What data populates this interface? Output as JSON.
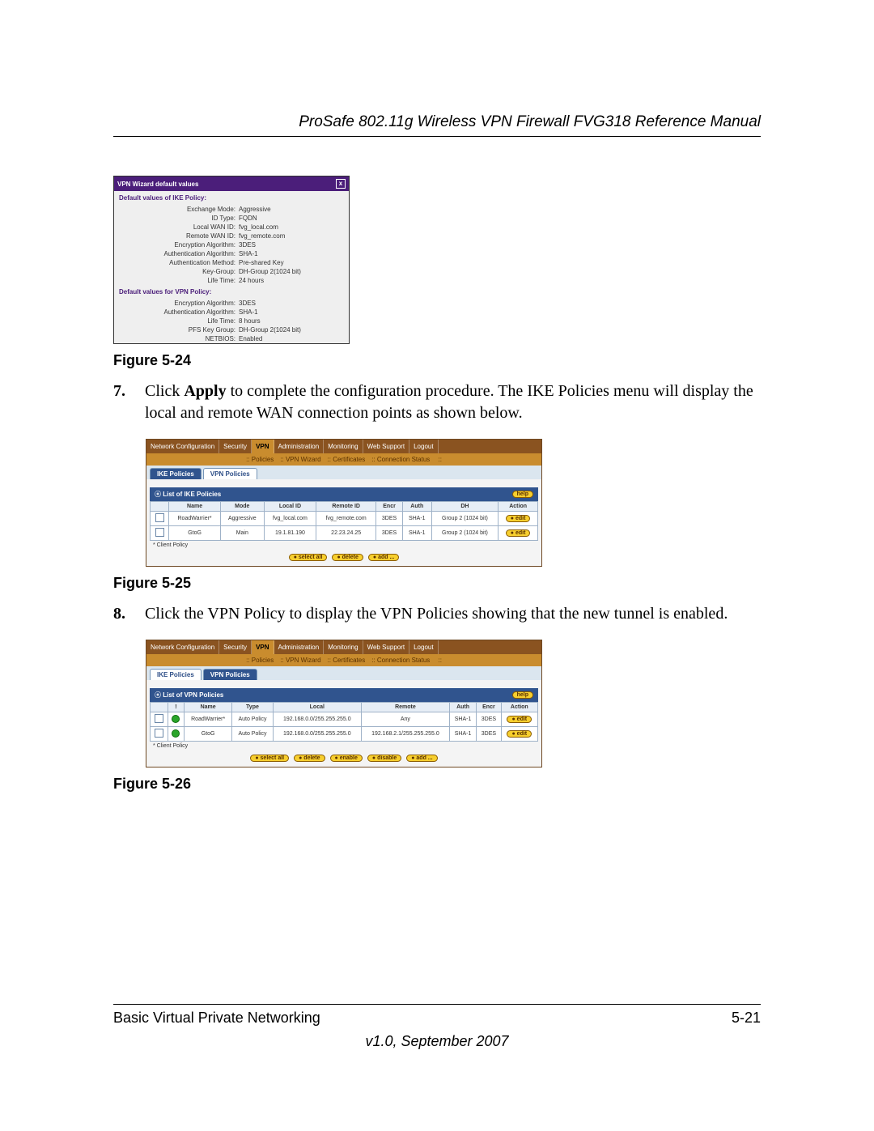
{
  "header": {
    "title": "ProSafe 802.11g Wireless VPN Firewall FVG318 Reference Manual"
  },
  "captions": {
    "f24": "Figure 5-24",
    "f25": "Figure 5-25",
    "f26": "Figure 5-26"
  },
  "step7": {
    "num": "7.",
    "lead": "Click ",
    "bold": "Apply",
    "rest": " to complete the configuration procedure. The IKE Policies menu will display the local and remote WAN connection points as shown below."
  },
  "step8": {
    "num": "8.",
    "text": "Click the VPN Policy to display the VPN Policies showing that the new tunnel is enabled."
  },
  "footer": {
    "left": "Basic Virtual Private Networking",
    "right": "5-21",
    "ver": "v1.0, September 2007"
  },
  "panel524": {
    "title": "VPN Wizard default values",
    "ike_head": "Default values of IKE Policy:",
    "ike": [
      {
        "k": "Exchange Mode:",
        "v": "Aggressive"
      },
      {
        "k": "ID Type:",
        "v": "FQDN"
      },
      {
        "k": "Local WAN ID:",
        "v": "fvg_local.com"
      },
      {
        "k": "Remote WAN ID:",
        "v": "fvg_remote.com"
      },
      {
        "k": "Encryption Algorithm:",
        "v": "3DES"
      },
      {
        "k": "Authentication Algorithm:",
        "v": "SHA-1"
      },
      {
        "k": "Authentication Method:",
        "v": "Pre-shared Key"
      },
      {
        "k": "Key-Group:",
        "v": "DH-Group 2(1024 bit)"
      },
      {
        "k": "Life Time:",
        "v": "24 hours"
      }
    ],
    "vpn_head": "Default values for VPN Policy:",
    "vpn": [
      {
        "k": "Encryption Algorithm:",
        "v": "3DES"
      },
      {
        "k": "Authentication Algorithm:",
        "v": "SHA-1"
      },
      {
        "k": "Life Time:",
        "v": "8 hours"
      },
      {
        "k": "PFS Key Group:",
        "v": "DH-Group 2(1024 bit)"
      },
      {
        "k": "NETBIOS:",
        "v": "Enabled"
      }
    ]
  },
  "router_common": {
    "nav": [
      "Network Configuration",
      "Security",
      "VPN",
      "Administration",
      "Monitoring",
      "Web Support",
      "Logout"
    ],
    "subnav": [
      "Policies",
      "VPN Wizard",
      "Certificates",
      "Connection Status"
    ],
    "tabs": [
      "IKE Policies",
      "VPN Policies"
    ],
    "help": "help",
    "note": "* Client Policy",
    "buttons_basic": [
      "select all",
      "delete",
      "add ..."
    ],
    "buttons_full": [
      "select all",
      "delete",
      "enable",
      "disable",
      "add ..."
    ]
  },
  "fig25": {
    "listTitle": "List of IKE Policies",
    "headers": [
      "",
      "Name",
      "Mode",
      "Local ID",
      "Remote ID",
      "Encr",
      "Auth",
      "DH",
      "Action"
    ],
    "rows": [
      {
        "name": "RoadWarrier*",
        "mode": "Aggressive",
        "local": "fvg_local.com",
        "remote": "fvg_remote.com",
        "encr": "3DES",
        "auth": "SHA-1",
        "dh": "Group 2 (1024 bit)",
        "action": "edit"
      },
      {
        "name": "GtoG",
        "mode": "Main",
        "local": "19.1.81.190",
        "remote": "22.23.24.25",
        "encr": "3DES",
        "auth": "SHA-1",
        "dh": "Group 2 (1024 bit)",
        "action": "edit"
      }
    ]
  },
  "fig26": {
    "listTitle": "List of VPN Policies",
    "headers": [
      "",
      "!",
      "Name",
      "Type",
      "Local",
      "Remote",
      "Auth",
      "Encr",
      "Action"
    ],
    "rows": [
      {
        "name": "RoadWarrier*",
        "type": "Auto Policy",
        "local": "192.168.0.0/255.255.255.0",
        "remote": "Any",
        "auth": "SHA-1",
        "encr": "3DES",
        "action": "edit"
      },
      {
        "name": "GtoG",
        "type": "Auto Policy",
        "local": "192.168.0.0/255.255.255.0",
        "remote": "192.168.2.1/255.255.255.0",
        "auth": "SHA-1",
        "encr": "3DES",
        "action": "edit"
      }
    ]
  }
}
